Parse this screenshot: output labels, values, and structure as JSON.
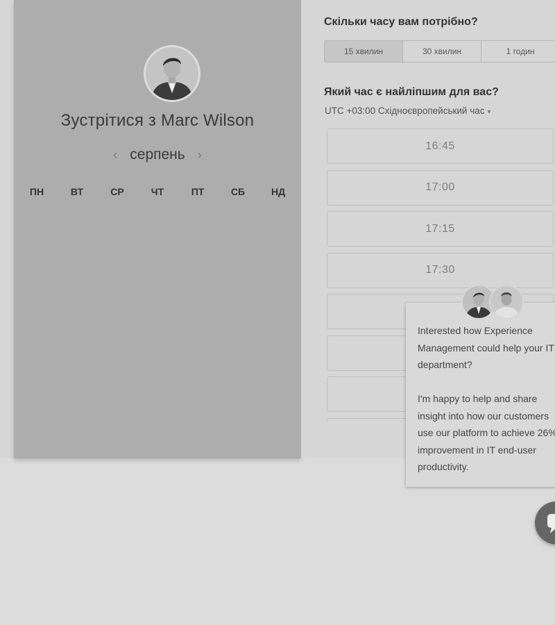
{
  "host": {
    "title": "Зустрітися з Marc Wilson",
    "avatar_icon": "person-portrait"
  },
  "calendar": {
    "month": "серпень",
    "prev_icon": "chevron-left-icon",
    "next_icon": "chevron-right-icon",
    "weekdays": [
      "ПН",
      "ВТ",
      "СР",
      "ЧТ",
      "ПТ",
      "СБ",
      "НД"
    ]
  },
  "duration": {
    "question": "Скільки часу вам потрібно?",
    "options": [
      "15 хвилин",
      "30 хвилин",
      "1 годин"
    ],
    "selected_index": 0
  },
  "time": {
    "question": "Який час є найліпшим для вас?",
    "timezone": "UTC +03:00 Східноєвропейський час",
    "caret": "▾",
    "slots": [
      "16:45",
      "17:00",
      "17:15",
      "17:30",
      "",
      "",
      "",
      ""
    ]
  },
  "chat": {
    "message_p1": "Interested how Experience Management could help your IT department?",
    "message_p2": "I'm happy to help and share insight into how our customers use our platform to achieve 26% improvement in IT end-user productivity.",
    "launcher_icon": "chat-bubble-icon"
  },
  "colors": {
    "left_panel": "#adadad",
    "right_panel": "#d6d6d6",
    "text_dark": "#333333",
    "text_muted": "#7d7d7d"
  }
}
